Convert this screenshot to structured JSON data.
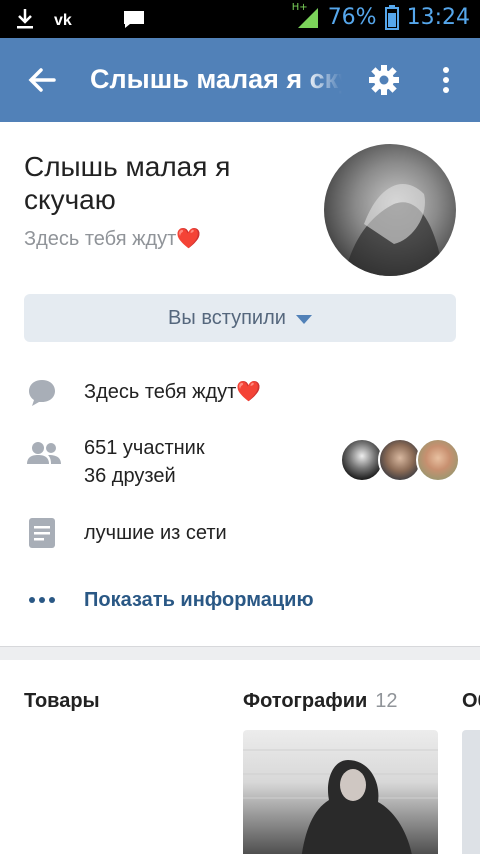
{
  "status_bar": {
    "network_label": "H+",
    "battery": "76%",
    "time": "13:24",
    "icons": [
      "download-icon",
      "vk-icon",
      "message-icon",
      "signal-icon",
      "battery-icon"
    ]
  },
  "toolbar": {
    "title": "Слышь малая я скучаю",
    "color": "#5181b8"
  },
  "group": {
    "name": "Слышь малая я скучаю",
    "status": "Здесь тебя ждут❤️"
  },
  "join_button": {
    "label": "Вы вступили"
  },
  "info": {
    "description": "Здесь тебя ждут❤️",
    "members": "651 участник",
    "friends": "36 друзей",
    "category": "лучшие из сети",
    "show_info": "Показать информацию"
  },
  "sections": {
    "goods": "Товары",
    "photos": "Фотографии",
    "photos_count": "12",
    "next": "Об"
  }
}
